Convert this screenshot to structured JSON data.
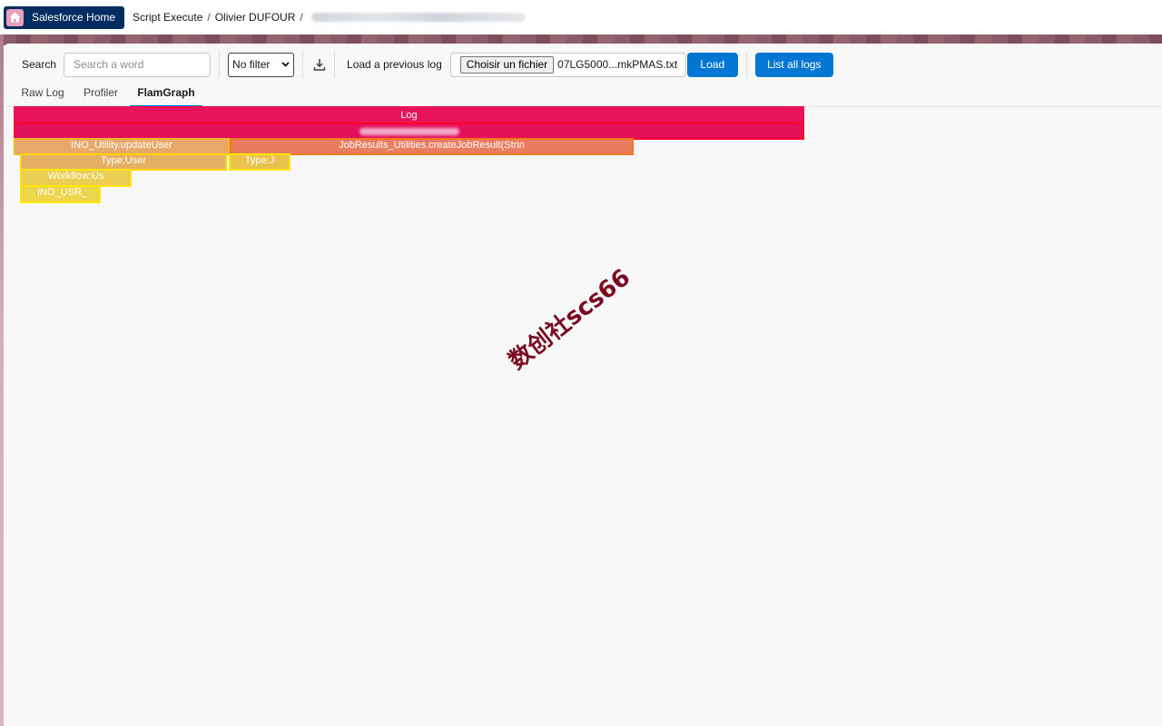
{
  "topbar": {
    "home_label": "Salesforce Home",
    "breadcrumbs": [
      "Script Execute",
      "Olivier DUFOUR"
    ],
    "separator": "/"
  },
  "toolbar": {
    "search_label": "Search",
    "search_placeholder": "Search a word",
    "filter_selected": "No filter",
    "load_previous_label": "Load a previous log",
    "choose_file_label": "Choisir un fichier",
    "file_name": "07LG5000...mkPMAS.txt",
    "load_label": "Load",
    "list_all_label": "List all logs"
  },
  "tabs": [
    {
      "label": "Raw Log",
      "active": false
    },
    {
      "label": "Profiler",
      "active": false
    },
    {
      "label": "FlamGraph",
      "active": true
    }
  ],
  "flamegraph": {
    "frames": [
      {
        "label": "Log",
        "depth": 0,
        "color": "#e8145a",
        "border": "#e8145a"
      },
      {
        "label": "",
        "depth": 1,
        "color": "#e3115a",
        "border": "#ff0033"
      },
      {
        "label": "INO_Utility.updateUser",
        "depth": 2,
        "color": "#e8a86a",
        "border": "#f5b52a"
      },
      {
        "label": "JobResults_Utilities.createJobResult(Strin",
        "depth": 2,
        "color": "#ea7c60",
        "border": "#f07a1a"
      },
      {
        "label": "Type:User",
        "depth": 3,
        "color": "#e5b064",
        "border": "#ffd400"
      },
      {
        "label": "Type:J",
        "depth": 3,
        "color": "#ecc24e",
        "border": "#ffe600"
      },
      {
        "label": "Workflow:Us",
        "depth": 4,
        "color": "#ebcf55",
        "border": "#ffe600"
      },
      {
        "label": "INO_USR_",
        "depth": 5,
        "color": "#eed54e",
        "border": "#ffe600"
      }
    ]
  },
  "watermark": "数创社scs66",
  "icons": {
    "home": "home-icon",
    "download": "download-icon",
    "dropdown": "chevron-down-icon"
  }
}
